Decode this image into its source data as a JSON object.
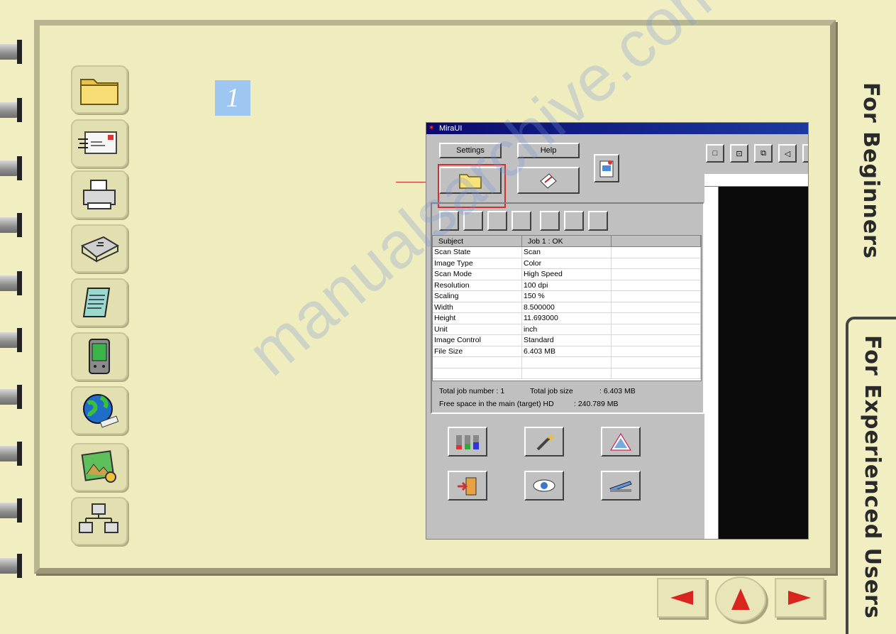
{
  "step_number": "1",
  "side_tabs": {
    "beginners": "For Beginners",
    "experienced": "For Experienced Users"
  },
  "sidebar_icons": [
    "folder-icon",
    "mail-icon",
    "printer-icon",
    "fax-icon",
    "notepad-icon",
    "handheld-icon",
    "globe-icon",
    "photo-icon",
    "network-icon"
  ],
  "app": {
    "title": "MiraUI",
    "settings_label": "Settings",
    "help_label": "Help",
    "table": {
      "headers": [
        "Subject",
        "Job 1 : OK",
        ""
      ],
      "rows": [
        [
          "Scan State",
          "Scan"
        ],
        [
          "Image Type",
          "Color"
        ],
        [
          "Scan Mode",
          "High Speed"
        ],
        [
          "Resolution",
          "100 dpi"
        ],
        [
          "Scaling",
          "150 %"
        ],
        [
          "Width",
          "8.500000"
        ],
        [
          "Height",
          "11.693000"
        ],
        [
          "Unit",
          "inch"
        ],
        [
          "Image Control",
          "Standard"
        ],
        [
          "File Size",
          "6.403   MB"
        ]
      ]
    },
    "status": {
      "total_job_number_label": "Total job number  :  1",
      "total_job_size_label": "Total job size",
      "total_job_size_value": ":  6.403   MB",
      "free_space_label": "Free space in the main (target) HD",
      "free_space_value": ":        240.789 MB"
    }
  },
  "watermark": "manualsarchive.com",
  "colors": {
    "accent_red": "#d8261f",
    "highlight_box": "#d32f2f",
    "badge": "#9dc7f0"
  }
}
